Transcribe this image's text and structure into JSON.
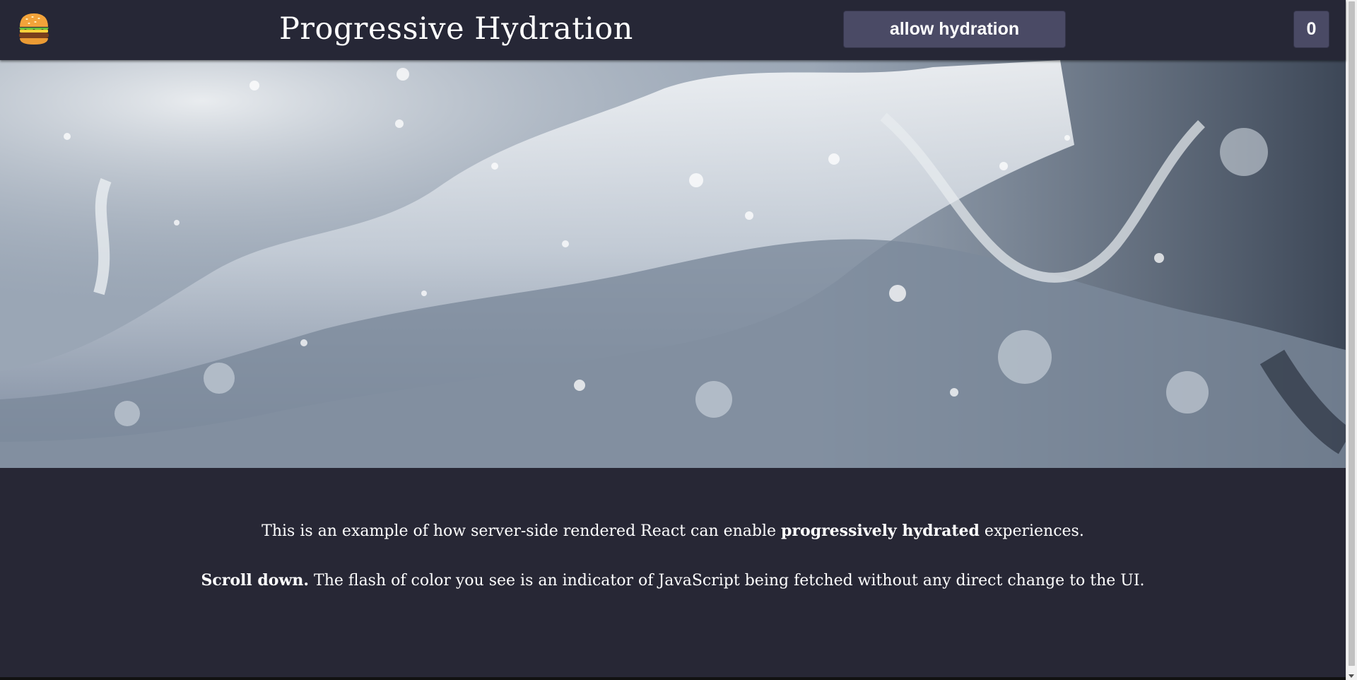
{
  "header": {
    "logo_icon": "hamburger-emoji-icon",
    "title": "Progressive Hydration",
    "hydrate_button_label": "allow hydration",
    "counter_value": "0"
  },
  "hero": {
    "image_subject": "water-splash-photo"
  },
  "content": {
    "p1_pre": "This is an example of how server-side rendered React can enable ",
    "p1_bold": "progressively hydrated",
    "p1_post": " experiences.",
    "p2_bold": "Scroll down.",
    "p2_post": " The flash of color you see is an indicator of JavaScript being fetched without any direct change to the UI."
  },
  "colors": {
    "background": "#272735",
    "header_bg": "#262736",
    "button_bg": "#4a4a65",
    "text": "#ffffff"
  }
}
